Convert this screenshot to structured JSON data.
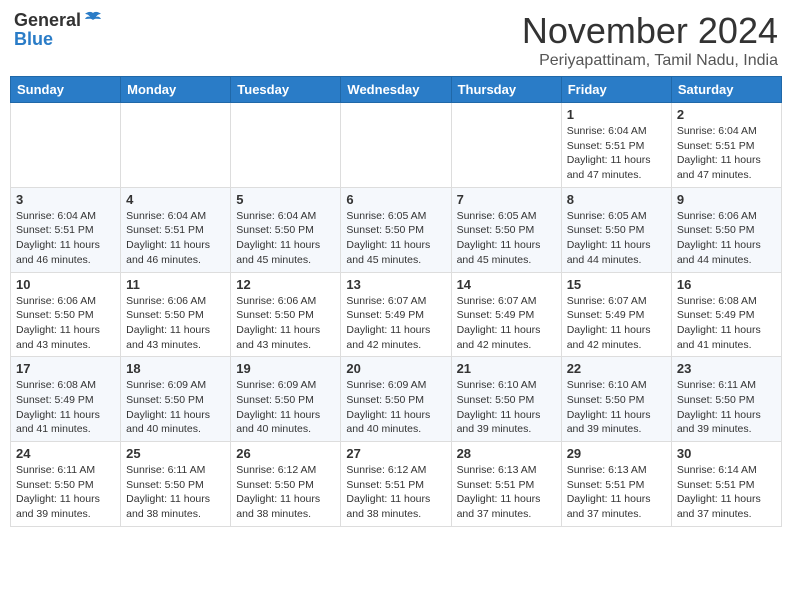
{
  "header": {
    "logo_general": "General",
    "logo_blue": "Blue",
    "month": "November 2024",
    "location": "Periyapattinam, Tamil Nadu, India"
  },
  "weekdays": [
    "Sunday",
    "Monday",
    "Tuesday",
    "Wednesday",
    "Thursday",
    "Friday",
    "Saturday"
  ],
  "weeks": [
    [
      {
        "day": "",
        "info": ""
      },
      {
        "day": "",
        "info": ""
      },
      {
        "day": "",
        "info": ""
      },
      {
        "day": "",
        "info": ""
      },
      {
        "day": "",
        "info": ""
      },
      {
        "day": "1",
        "info": "Sunrise: 6:04 AM\nSunset: 5:51 PM\nDaylight: 11 hours\nand 47 minutes."
      },
      {
        "day": "2",
        "info": "Sunrise: 6:04 AM\nSunset: 5:51 PM\nDaylight: 11 hours\nand 47 minutes."
      }
    ],
    [
      {
        "day": "3",
        "info": "Sunrise: 6:04 AM\nSunset: 5:51 PM\nDaylight: 11 hours\nand 46 minutes."
      },
      {
        "day": "4",
        "info": "Sunrise: 6:04 AM\nSunset: 5:51 PM\nDaylight: 11 hours\nand 46 minutes."
      },
      {
        "day": "5",
        "info": "Sunrise: 6:04 AM\nSunset: 5:50 PM\nDaylight: 11 hours\nand 45 minutes."
      },
      {
        "day": "6",
        "info": "Sunrise: 6:05 AM\nSunset: 5:50 PM\nDaylight: 11 hours\nand 45 minutes."
      },
      {
        "day": "7",
        "info": "Sunrise: 6:05 AM\nSunset: 5:50 PM\nDaylight: 11 hours\nand 45 minutes."
      },
      {
        "day": "8",
        "info": "Sunrise: 6:05 AM\nSunset: 5:50 PM\nDaylight: 11 hours\nand 44 minutes."
      },
      {
        "day": "9",
        "info": "Sunrise: 6:06 AM\nSunset: 5:50 PM\nDaylight: 11 hours\nand 44 minutes."
      }
    ],
    [
      {
        "day": "10",
        "info": "Sunrise: 6:06 AM\nSunset: 5:50 PM\nDaylight: 11 hours\nand 43 minutes."
      },
      {
        "day": "11",
        "info": "Sunrise: 6:06 AM\nSunset: 5:50 PM\nDaylight: 11 hours\nand 43 minutes."
      },
      {
        "day": "12",
        "info": "Sunrise: 6:06 AM\nSunset: 5:50 PM\nDaylight: 11 hours\nand 43 minutes."
      },
      {
        "day": "13",
        "info": "Sunrise: 6:07 AM\nSunset: 5:49 PM\nDaylight: 11 hours\nand 42 minutes."
      },
      {
        "day": "14",
        "info": "Sunrise: 6:07 AM\nSunset: 5:49 PM\nDaylight: 11 hours\nand 42 minutes."
      },
      {
        "day": "15",
        "info": "Sunrise: 6:07 AM\nSunset: 5:49 PM\nDaylight: 11 hours\nand 42 minutes."
      },
      {
        "day": "16",
        "info": "Sunrise: 6:08 AM\nSunset: 5:49 PM\nDaylight: 11 hours\nand 41 minutes."
      }
    ],
    [
      {
        "day": "17",
        "info": "Sunrise: 6:08 AM\nSunset: 5:49 PM\nDaylight: 11 hours\nand 41 minutes."
      },
      {
        "day": "18",
        "info": "Sunrise: 6:09 AM\nSunset: 5:50 PM\nDaylight: 11 hours\nand 40 minutes."
      },
      {
        "day": "19",
        "info": "Sunrise: 6:09 AM\nSunset: 5:50 PM\nDaylight: 11 hours\nand 40 minutes."
      },
      {
        "day": "20",
        "info": "Sunrise: 6:09 AM\nSunset: 5:50 PM\nDaylight: 11 hours\nand 40 minutes."
      },
      {
        "day": "21",
        "info": "Sunrise: 6:10 AM\nSunset: 5:50 PM\nDaylight: 11 hours\nand 39 minutes."
      },
      {
        "day": "22",
        "info": "Sunrise: 6:10 AM\nSunset: 5:50 PM\nDaylight: 11 hours\nand 39 minutes."
      },
      {
        "day": "23",
        "info": "Sunrise: 6:11 AM\nSunset: 5:50 PM\nDaylight: 11 hours\nand 39 minutes."
      }
    ],
    [
      {
        "day": "24",
        "info": "Sunrise: 6:11 AM\nSunset: 5:50 PM\nDaylight: 11 hours\nand 39 minutes."
      },
      {
        "day": "25",
        "info": "Sunrise: 6:11 AM\nSunset: 5:50 PM\nDaylight: 11 hours\nand 38 minutes."
      },
      {
        "day": "26",
        "info": "Sunrise: 6:12 AM\nSunset: 5:50 PM\nDaylight: 11 hours\nand 38 minutes."
      },
      {
        "day": "27",
        "info": "Sunrise: 6:12 AM\nSunset: 5:51 PM\nDaylight: 11 hours\nand 38 minutes."
      },
      {
        "day": "28",
        "info": "Sunrise: 6:13 AM\nSunset: 5:51 PM\nDaylight: 11 hours\nand 37 minutes."
      },
      {
        "day": "29",
        "info": "Sunrise: 6:13 AM\nSunset: 5:51 PM\nDaylight: 11 hours\nand 37 minutes."
      },
      {
        "day": "30",
        "info": "Sunrise: 6:14 AM\nSunset: 5:51 PM\nDaylight: 11 hours\nand 37 minutes."
      }
    ]
  ]
}
